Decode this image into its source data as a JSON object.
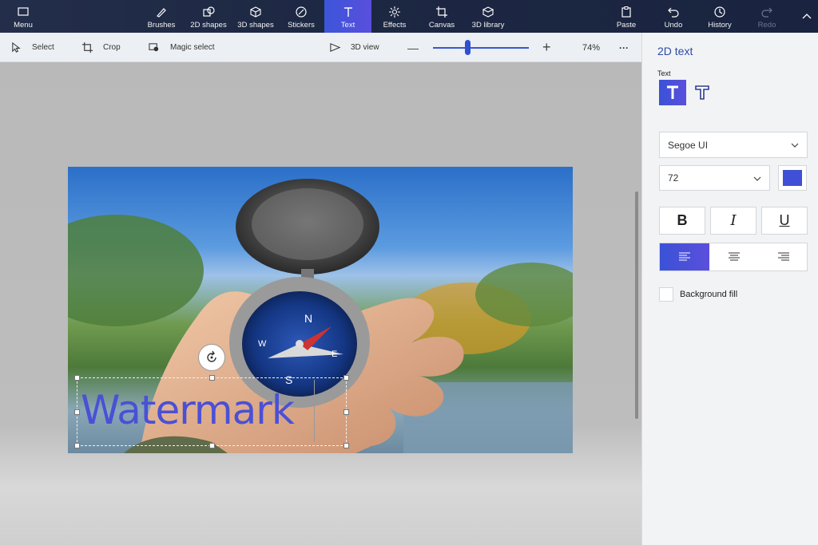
{
  "ribbon": {
    "menu_label": "Menu",
    "tools": [
      {
        "label": "Brushes"
      },
      {
        "label": "2D shapes"
      },
      {
        "label": "3D shapes"
      },
      {
        "label": "Stickers"
      },
      {
        "label": "Text"
      },
      {
        "label": "Effects"
      },
      {
        "label": "Canvas"
      },
      {
        "label": "3D library"
      }
    ],
    "actions": [
      {
        "label": "Paste"
      },
      {
        "label": "Undo"
      },
      {
        "label": "History"
      },
      {
        "label": "Redo"
      }
    ],
    "active_tool": "Text"
  },
  "toolbar": {
    "select_label": "Select",
    "crop_label": "Crop",
    "magic_select_label": "Magic select",
    "view3d_label": "3D view",
    "zoom_out": "—",
    "zoom_in": "+",
    "zoom_level": "74%",
    "zoom_fraction": 0.35,
    "more": "···"
  },
  "canvas": {
    "text_content": "Watermark",
    "text_color": "#4a50d6"
  },
  "panel": {
    "title": "2D text",
    "text_label": "Text",
    "font_family": "Segoe UI",
    "font_size": "72",
    "text_color": "#3f4fd6",
    "bold": "B",
    "italic": "I",
    "underline": "U",
    "alignment": "left",
    "background_fill_label": "Background fill",
    "background_fill": false
  },
  "colors": {
    "accent": "#3b55d9",
    "ribbon": "#1c2742"
  }
}
